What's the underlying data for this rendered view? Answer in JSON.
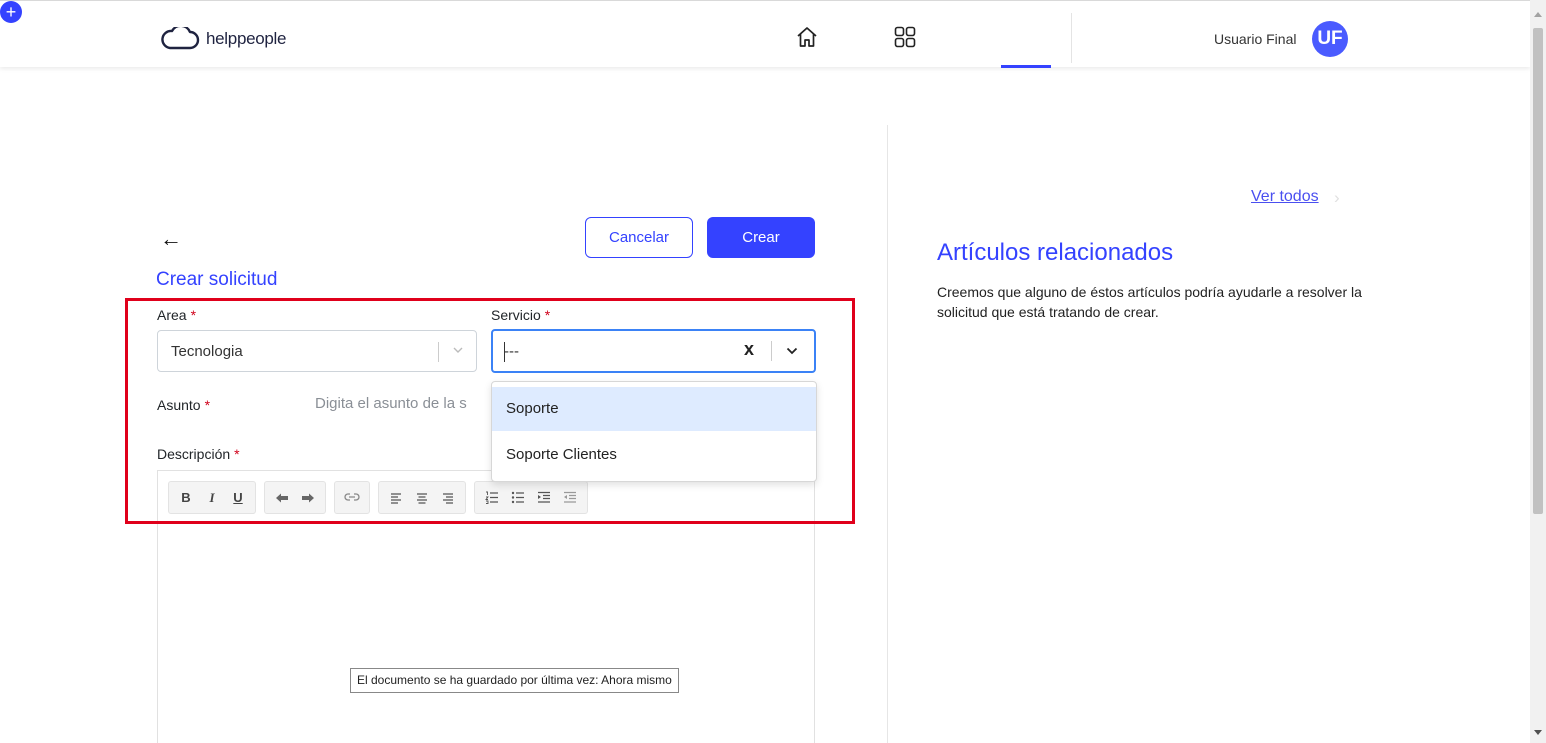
{
  "header": {
    "logo_text": "helppeople",
    "user_name": "Usuario Final",
    "user_initials": "UF",
    "nav_add_symbol": "+"
  },
  "form": {
    "back_symbol": "←",
    "cancel_label": "Cancelar",
    "create_label": "Crear",
    "title": "Crear solicitud",
    "area_label": "Area",
    "area_value": "Tecnologia",
    "servicio_label": "Servicio",
    "servicio_value": "---",
    "required_mark": "*",
    "asunto_label": "Asunto",
    "asunto_placeholder": "Digita el asunto de la s",
    "descripcion_label": "Descripción",
    "clear_symbol": "x",
    "servicio_options": [
      "Soporte",
      "Soporte Clientes"
    ],
    "saved_tooltip": "El documento se ha guardado por última vez: Ahora mismo"
  },
  "editor_toolbar": {
    "bold": "B",
    "italic": "I",
    "underline": "U"
  },
  "side_panel": {
    "ver_todos": "Ver todos",
    "chevron": "›",
    "title": "Artículos relacionados",
    "text": "Creemos que alguno de éstos artículos podría ayudarle a resolver la solicitud que está tratando de crear."
  },
  "colors": {
    "accent": "#3442ff",
    "highlight_frame": "#e0001b",
    "focus_border": "#3b82f6",
    "option_hover": "#deebff"
  },
  "icons": [
    "cloud-logo-icon",
    "home-icon",
    "apps-grid-icon",
    "plus-circle-icon",
    "chevron-down-icon",
    "undo-icon",
    "redo-icon",
    "unlink-icon",
    "align-left-icon",
    "align-center-icon",
    "align-right-icon",
    "ordered-list-icon",
    "unordered-list-icon",
    "indent-icon",
    "outdent-icon"
  ]
}
